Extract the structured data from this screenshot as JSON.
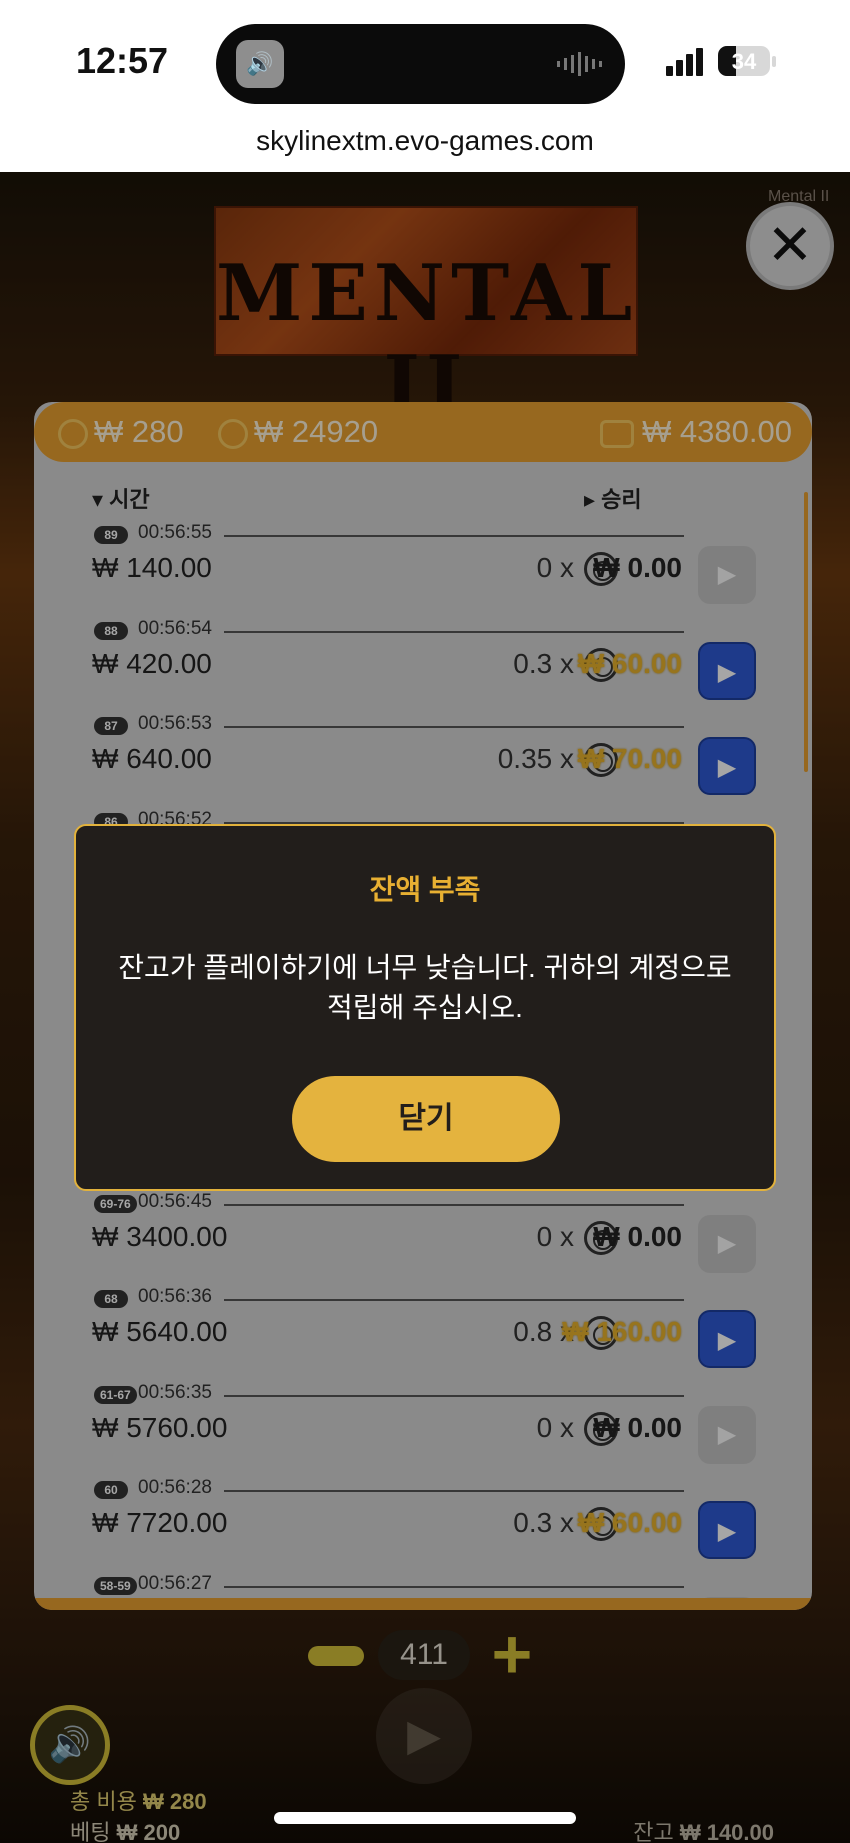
{
  "status_bar": {
    "time": "12:57",
    "battery": "34",
    "battery_level": 0.34
  },
  "browser": {
    "url": "skylinextm.evo-games.com"
  },
  "game": {
    "logo_text": "MENTAL II",
    "brand": "Mental II",
    "balances": {
      "coin1": "₩ 280",
      "coin2": "₩ 24920",
      "wallet": "₩ 4380.00"
    },
    "headers": {
      "time": "▾ 시간",
      "win": "▸ 승리"
    },
    "rows": [
      {
        "tag": "89",
        "time": "00:56:55",
        "bet": "₩ 140.00",
        "mult": "0 x",
        "win": "₩ 0.00",
        "positive": false
      },
      {
        "tag": "88",
        "time": "00:56:54",
        "bet": "₩ 420.00",
        "mult": "0.3 x",
        "win": "₩ 60.00",
        "positive": true
      },
      {
        "tag": "87",
        "time": "00:56:53",
        "bet": "₩ 640.00",
        "mult": "0.35 x",
        "win": "₩ 70.00",
        "positive": true
      },
      {
        "tag": "86",
        "time": "00:56:52",
        "bet": "",
        "mult": "",
        "win": "",
        "positive": true
      },
      {
        "tag": "",
        "time": "",
        "bet": "",
        "mult": "",
        "win": "",
        "positive": false
      },
      {
        "tag": "",
        "time": "",
        "bet": "",
        "mult": "",
        "win": "",
        "positive": false
      },
      {
        "tag": "",
        "time": "",
        "bet": "",
        "mult": "",
        "win": "",
        "positive": false
      },
      {
        "tag": "69-76",
        "time": "00:56:45",
        "bet": "₩ 3400.00",
        "mult": "0 x",
        "win": "₩ 0.00",
        "positive": false
      },
      {
        "tag": "68",
        "time": "00:56:36",
        "bet": "₩ 5640.00",
        "mult": "0.8 x",
        "win": "₩ 160.00",
        "positive": true
      },
      {
        "tag": "61-67",
        "time": "00:56:35",
        "bet": "₩ 5760.00",
        "mult": "0 x",
        "win": "₩ 0.00",
        "positive": false
      },
      {
        "tag": "60",
        "time": "00:56:28",
        "bet": "₩ 7720.00",
        "mult": "0.3 x",
        "win": "₩ 60.00",
        "positive": true
      },
      {
        "tag": "58-59",
        "time": "00:56:27",
        "bet": "",
        "mult": "",
        "win": "",
        "positive": false
      }
    ],
    "controls": {
      "amount": "411",
      "total_cost_label": "총 비용",
      "total_cost": "₩ 280",
      "bet_label": "베팅",
      "bet": "₩ 200",
      "balance_label": "잔고",
      "balance": "₩ 140.00"
    }
  },
  "modal": {
    "title": "잔액 부족",
    "body": "잔고가 플레이하기에 너무 낮습니다. 귀하의 계정으로 적립해 주십시오.",
    "button": "닫기"
  },
  "colors": {
    "accent": "#e8a030",
    "modal_title": "#e8b032",
    "button": "#e4b33e",
    "play_active": "#2f5ad4"
  }
}
